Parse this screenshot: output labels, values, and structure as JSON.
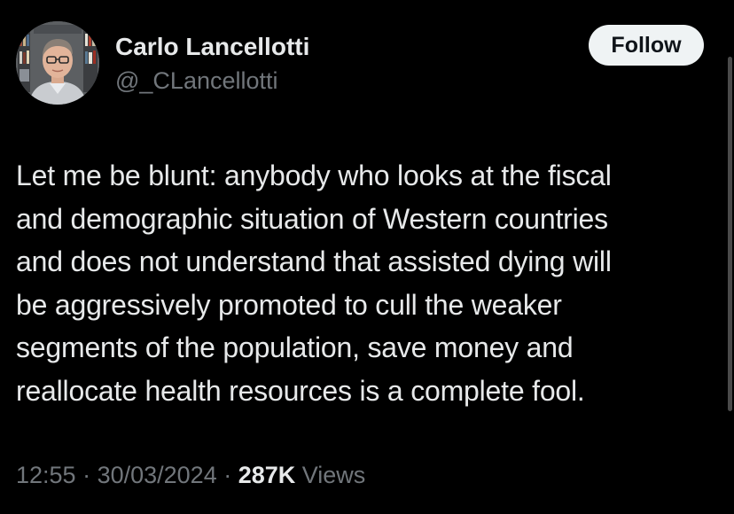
{
  "user": {
    "display_name": "Carlo Lancellotti",
    "handle": "@_CLancellotti"
  },
  "follow_button": {
    "label": "Follow"
  },
  "tweet": {
    "lines": [
      "Let me be blunt: anybody who looks at the fiscal",
      "and demographic situation of Western countries",
      "and does not understand that assisted dying will",
      "be aggressively promoted to cull the weaker",
      "segments of the population, save money and",
      "reallocate health resources is a complete fool."
    ]
  },
  "meta": {
    "time": "12:55",
    "separator1": " · ",
    "date": "30/03/2024",
    "separator2": " · ",
    "views_count": "287K",
    "views_label": " Views"
  },
  "colors": {
    "background": "#000000",
    "primary_text": "#e7e9ea",
    "secondary_text": "#71767b",
    "follow_bg": "#eff3f4",
    "follow_text": "#0f1419"
  },
  "icons": {
    "avatar": "profile-photo"
  }
}
